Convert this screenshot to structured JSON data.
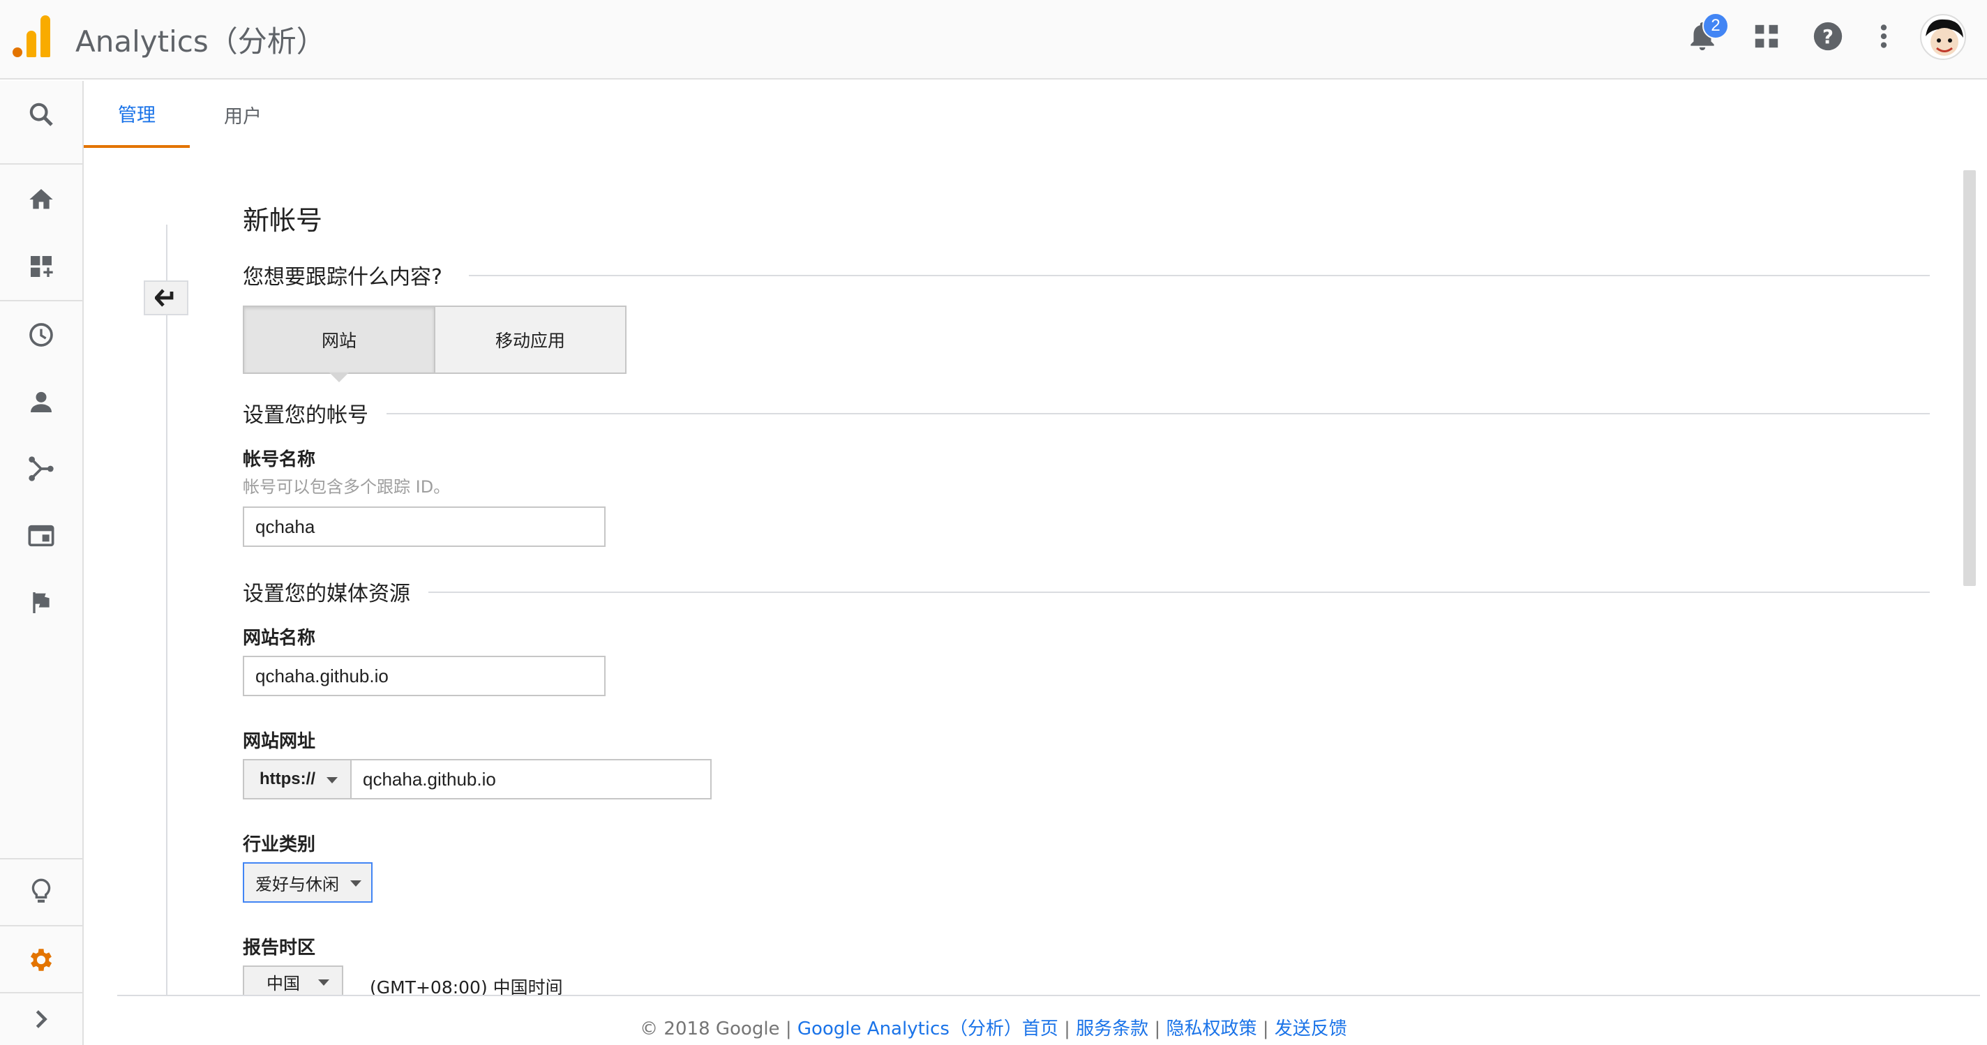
{
  "header": {
    "app_title": "Analytics（分析）",
    "notification_count": "2"
  },
  "tabs": [
    {
      "label": "管理",
      "active": true
    },
    {
      "label": "用户",
      "active": false
    }
  ],
  "form": {
    "heading": "新帐号",
    "track_question": "您想要跟踪什么内容?",
    "segment": {
      "options": [
        "网站",
        "移动应用"
      ],
      "selected": "网站"
    },
    "account_section": "设置您的帐号",
    "account_name_label": "帐号名称",
    "account_name_hint": "帐号可以包含多个跟踪 ID。",
    "account_name_value": "qchaha",
    "property_section": "设置您的媒体资源",
    "site_name_label": "网站名称",
    "site_name_value": "qchaha.github.io",
    "site_url_label": "网站网址",
    "protocol_value": "https://",
    "site_url_value": "qchaha.github.io",
    "industry_label": "行业类别",
    "industry_value": "爱好与休闲",
    "timezone_label": "报告时区",
    "country_value": "中国",
    "timezone_value": "(GMT+08:00) 中国时间"
  },
  "footer": {
    "copyright": "© 2018 Google | ",
    "links": [
      "Google Analytics（分析）首页",
      "服务条款",
      "隐私权政策",
      "发送反馈"
    ],
    "separator": " | "
  },
  "colors": {
    "accent": "#1a73e8",
    "brand_orange": "#e37400",
    "brand_yellow": "#f9ab00",
    "badge_blue": "#4285f4"
  }
}
